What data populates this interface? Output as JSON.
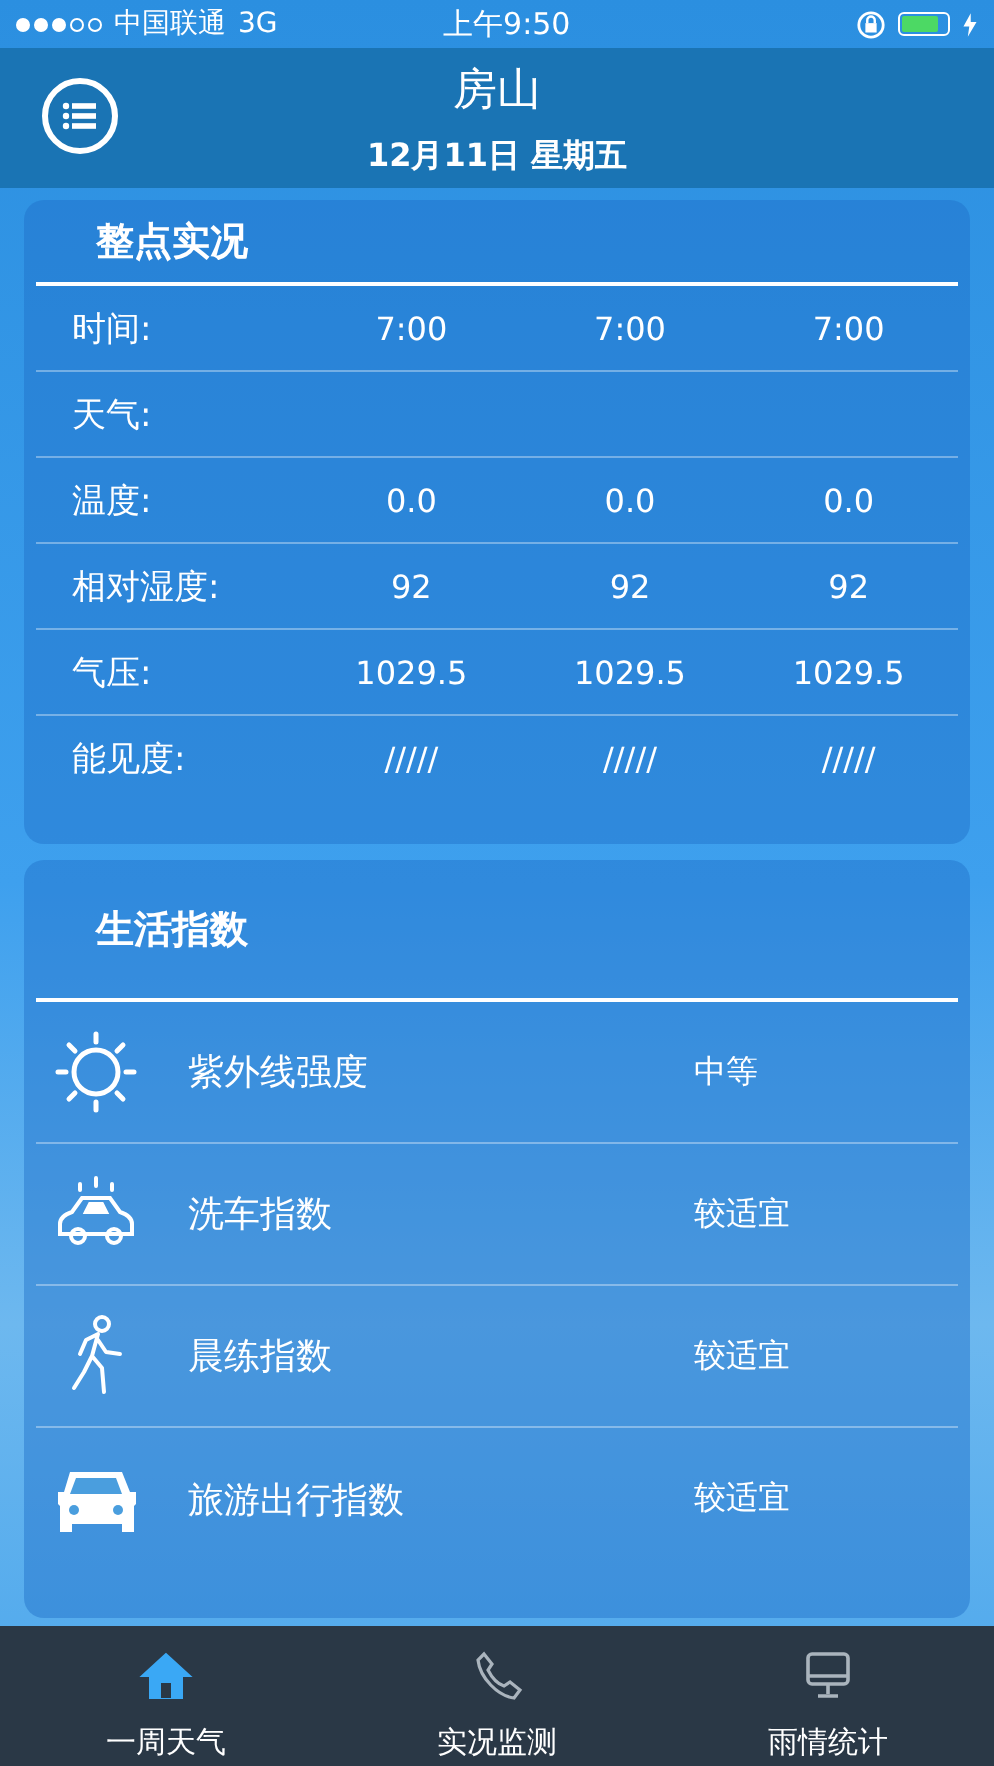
{
  "status_bar": {
    "carrier": "中国联通",
    "network": "3G",
    "time": "上午9:50"
  },
  "header": {
    "city": "房山",
    "date": "12月11日 星期五"
  },
  "hourly": {
    "title": "整点实况",
    "rows": [
      {
        "label": "时间:",
        "values": [
          "7:00",
          "7:00",
          "7:00"
        ]
      },
      {
        "label": "天气:"
      },
      {
        "label": "温度:",
        "values": [
          "0.0",
          "0.0",
          "0.0"
        ]
      },
      {
        "label": "相对湿度:",
        "values": [
          "92",
          "92",
          "92"
        ]
      },
      {
        "label": "气压:",
        "values": [
          "1029.5",
          "1029.5",
          "1029.5"
        ]
      },
      {
        "label": "能见度:",
        "values": [
          "/////",
          "/////",
          "/////"
        ]
      }
    ]
  },
  "life_index": {
    "title": "生活指数",
    "items": [
      {
        "kind": "sun",
        "name": "紫外线强度",
        "value": "中等"
      },
      {
        "kind": "car-wash",
        "name": "洗车指数",
        "value": "较适宜"
      },
      {
        "kind": "runner",
        "name": "晨练指数",
        "value": "较适宜"
      },
      {
        "kind": "car",
        "name": "旅游出行指数",
        "value": "较适宜"
      }
    ]
  },
  "tab_bar": [
    {
      "kind": "home",
      "label": "一周天气",
      "selected": true
    },
    {
      "kind": "phone",
      "label": "实况监测",
      "selected": false
    },
    {
      "kind": "monitor",
      "label": "雨情统计",
      "selected": false
    }
  ]
}
